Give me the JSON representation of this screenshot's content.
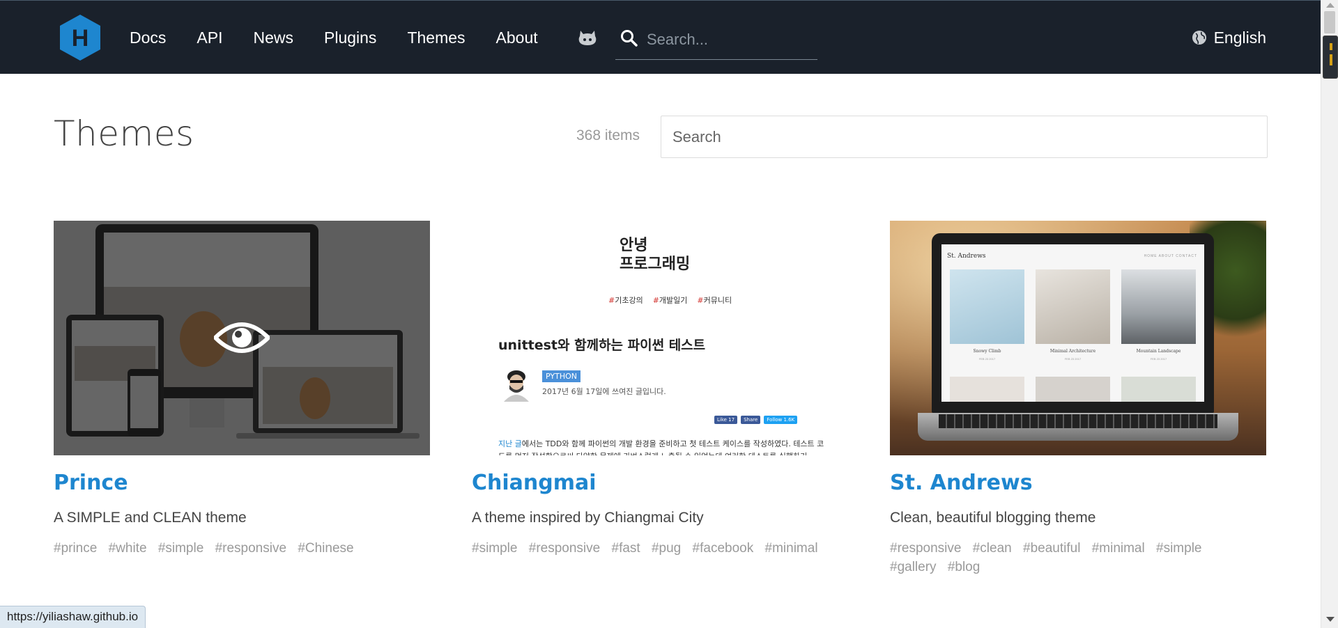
{
  "header": {
    "logo_letter": "H",
    "nav": [
      "Docs",
      "API",
      "News",
      "Plugins",
      "Themes",
      "About"
    ],
    "search_placeholder": "Search...",
    "language": "English"
  },
  "page": {
    "title": "Themes",
    "count": "368 items",
    "search_placeholder": "Search"
  },
  "cards": [
    {
      "name": "Prince",
      "description": "A SIMPLE and CLEAN theme",
      "tags": [
        "#prince",
        "#white",
        "#simple",
        "#responsive",
        "#Chinese"
      ]
    },
    {
      "name": "Chiangmai",
      "description": "A theme inspired by Chiangmai City",
      "tags": [
        "#simple",
        "#responsive",
        "#fast",
        "#pug",
        "#facebook",
        "#minimal"
      ],
      "preview": {
        "heading_line1": "안녕",
        "heading_line2": "프로그래밍",
        "categories": [
          "기초강의",
          "개발일기",
          "커뮤니티"
        ],
        "post_title": "unittest와 함께하는 파이썬 테스트",
        "badge": "PYTHON",
        "date": "2017년 6월 17일에 쓰여진 글입니다.",
        "social": [
          "Like 17",
          "Share",
          "Follow 1.6K"
        ],
        "body_link": "지난 글",
        "body_text": "에서는 TDD와 함께 파이썬의 개발 환경을 준비하고 첫 테스트 케이스를 작성하였다. 테스트 코드를 먼저 작성함으로써 다양한 문제에 가벼스럽게 노출될 수 있었는데 여러한 테스트를 실행하기"
      }
    },
    {
      "name": "St. Andrews",
      "description": "Clean, beautiful blogging theme",
      "tags": [
        "#responsive",
        "#clean",
        "#beautiful",
        "#minimal",
        "#simple",
        "#gallery",
        "#blog"
      ],
      "preview": {
        "site_title": "St. Andrews",
        "nav": "HOME  ABOUT  CONTACT",
        "posts": [
          "Snowy Climb",
          "Minimal Architecture",
          "Mountain Landscape"
        ],
        "post_date": "FEB 23 2017"
      }
    }
  ],
  "status_url": "https://yiliashaw.github.io",
  "colors": {
    "header_bg": "#1a212b",
    "link_blue": "#1e86cf",
    "logo_blue": "#1e86cf"
  }
}
